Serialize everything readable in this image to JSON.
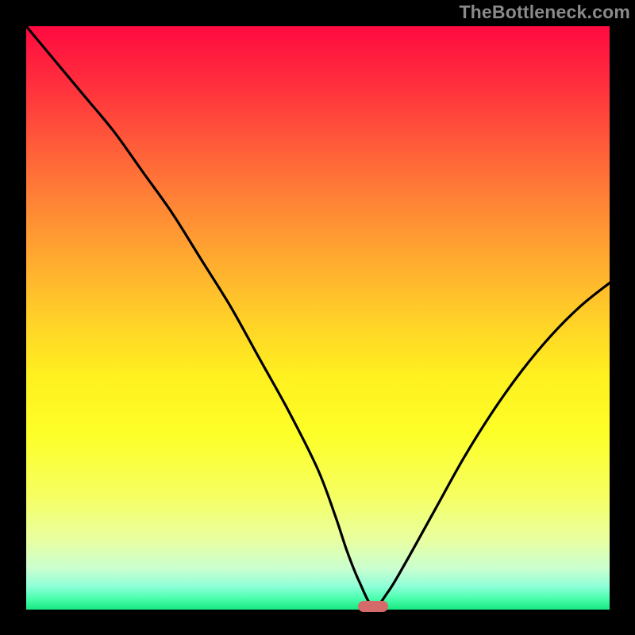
{
  "watermark": "TheBottleneck.com",
  "chart_data": {
    "type": "line",
    "title": "",
    "xlabel": "",
    "ylabel": "",
    "xlim": [
      0,
      100
    ],
    "ylim": [
      0,
      100
    ],
    "grid": false,
    "legend": false,
    "background_gradient": {
      "direction": "vertical",
      "stops": [
        {
          "pos": 0,
          "color": "#ff0a40"
        },
        {
          "pos": 50,
          "color": "#ffd028"
        },
        {
          "pos": 80,
          "color": "#f6ff5e"
        },
        {
          "pos": 100,
          "color": "#18e880"
        }
      ]
    },
    "series": [
      {
        "name": "bottleneck-curve",
        "x": [
          0,
          5,
          10,
          15,
          20,
          25,
          30,
          35,
          40,
          45,
          50,
          53,
          55,
          57,
          59.5,
          62,
          65,
          70,
          75,
          80,
          85,
          90,
          95,
          100
        ],
        "y": [
          100,
          94,
          88,
          82,
          75,
          68,
          60,
          52,
          43,
          34,
          24,
          16,
          10,
          5,
          0.5,
          3,
          8,
          17,
          26,
          34,
          41,
          47,
          52,
          56
        ]
      }
    ],
    "marker": {
      "name": "optimal-point",
      "x": 59.5,
      "y": 0.5,
      "color": "#d46a6a"
    }
  }
}
